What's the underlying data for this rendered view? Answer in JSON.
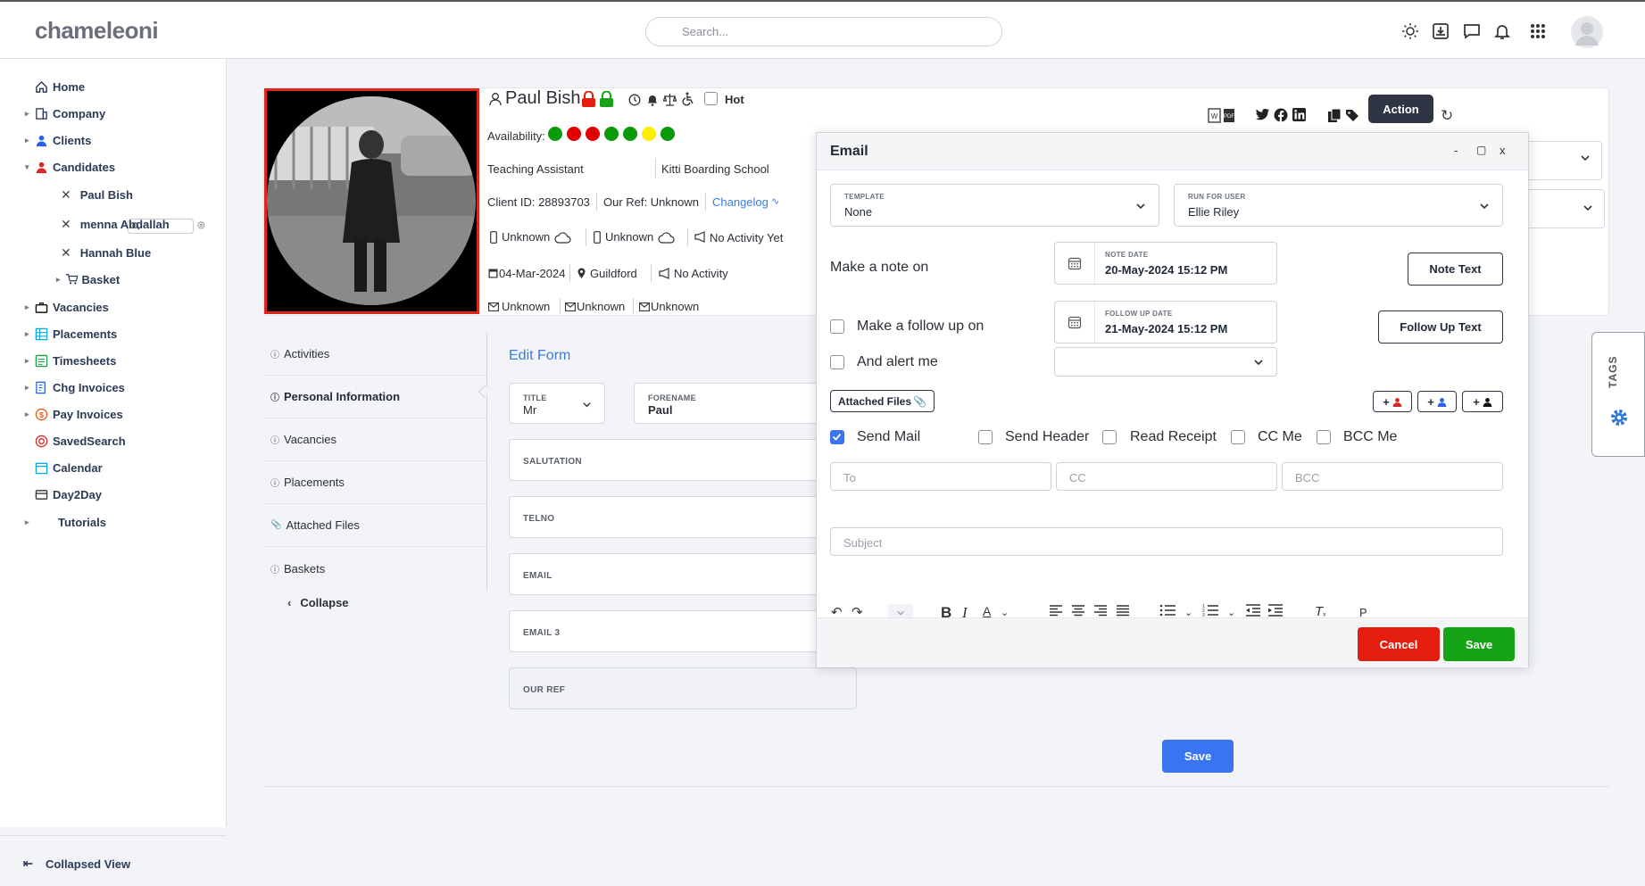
{
  "app": {
    "logo": "chameleoni",
    "search_placeholder": "Search..."
  },
  "topbar_icons": [
    "sun-icon",
    "download-icon",
    "chat-icon",
    "bell-icon",
    "apps-grid-icon",
    "user-avatar"
  ],
  "sidebar": {
    "items": [
      {
        "label": "Home",
        "icon": "home-icon"
      },
      {
        "label": "Company",
        "icon": "building-icon"
      },
      {
        "label": "Clients",
        "icon": "person-icon"
      },
      {
        "label": "Candidates",
        "icon": "person-icon"
      },
      {
        "label": "Vacancies",
        "icon": "briefcase-icon"
      },
      {
        "label": "Placements",
        "icon": "grid-icon"
      },
      {
        "label": "Timesheets",
        "icon": "timesheet-icon"
      },
      {
        "label": "Chg Invoices",
        "icon": "invoice-icon"
      },
      {
        "label": "Pay Invoices",
        "icon": "pound-icon"
      },
      {
        "label": "SavedSearch",
        "icon": "target-icon"
      },
      {
        "label": "Calendar",
        "icon": "calendar-icon"
      },
      {
        "label": "Day2Day",
        "icon": "card-icon"
      },
      {
        "label": "Tutorials",
        "icon": ""
      }
    ],
    "candidates": [
      "Paul Bish",
      "menna Abdallah",
      "Hannah Blue"
    ],
    "basket": "Basket",
    "collapsed_view": "Collapsed View"
  },
  "candidate": {
    "name": "Paul Bish",
    "hot_label": "Hot",
    "availability_label": "Availability:",
    "availability_colors": [
      "#0a9a0a",
      "#e00000",
      "#e00000",
      "#0a9a0a",
      "#0a9a0a",
      "#ffee00",
      "#0a9a0a"
    ],
    "job_title": "Teaching Assistant",
    "school": "Kitti Boarding School",
    "client_id": "Client ID: 28893703",
    "our_ref": "Our Ref: Unknown",
    "changelog": "Changelog",
    "phone1": "Unknown",
    "phone2": "Unknown",
    "activity_yet": "No Activity Yet",
    "date": "04-Mar-2024",
    "location": "Guildford",
    "activity": "No Activity",
    "email1": "Unknown",
    "email2": "Unknown",
    "email3": "Unknown",
    "action_label": "Action"
  },
  "tabs": [
    {
      "label": "Activities",
      "active": false
    },
    {
      "label": "Personal Information",
      "active": true
    },
    {
      "label": "Vacancies",
      "active": false
    },
    {
      "label": "Placements",
      "active": false
    },
    {
      "label": "Attached Files",
      "active": false
    },
    {
      "label": "Baskets",
      "active": false
    }
  ],
  "collapse_label": "Collapse",
  "form": {
    "title": "Edit Form",
    "title_label": "TITLE",
    "title_value": "Mr",
    "forename_label": "FORENAME",
    "forename_value": "Paul",
    "salutation": "SALUTATION",
    "telno": "TELNO",
    "email": "EMAIL",
    "email3": "EMAIL 3",
    "our_ref": "OUR REF",
    "save": "Save"
  },
  "tags_label": "TAGS",
  "modal": {
    "title": "Email",
    "controls": [
      "-",
      "▢",
      "x"
    ],
    "template_label": "TEMPLATE",
    "template_value": "None",
    "run_for_user_label": "RUN FOR USER",
    "run_for_user_value": "Ellie Riley",
    "make_note": "Make a note on",
    "note_date_label": "NOTE DATE",
    "note_date_value": "20-May-2024 15:12 PM",
    "note_text_btn": "Note Text",
    "follow_up": "Make a follow up on",
    "follow_up_date_label": "FOLLOW UP DATE",
    "follow_up_date_value": "21-May-2024 15:12 PM",
    "follow_up_btn": "Follow Up Text",
    "alert_me": "And alert me",
    "attached_files": "Attached Files",
    "send_mail": "Send Mail",
    "send_header": "Send Header",
    "read_receipt": "Read Receipt",
    "cc_me": "CC Me",
    "bcc_me": "BCC Me",
    "to_placeholder": "To",
    "cc_placeholder": "CC",
    "bcc_placeholder": "BCC",
    "subject_placeholder": "Subject",
    "paragraph": "P",
    "cancel": "Cancel",
    "save": "Save"
  }
}
